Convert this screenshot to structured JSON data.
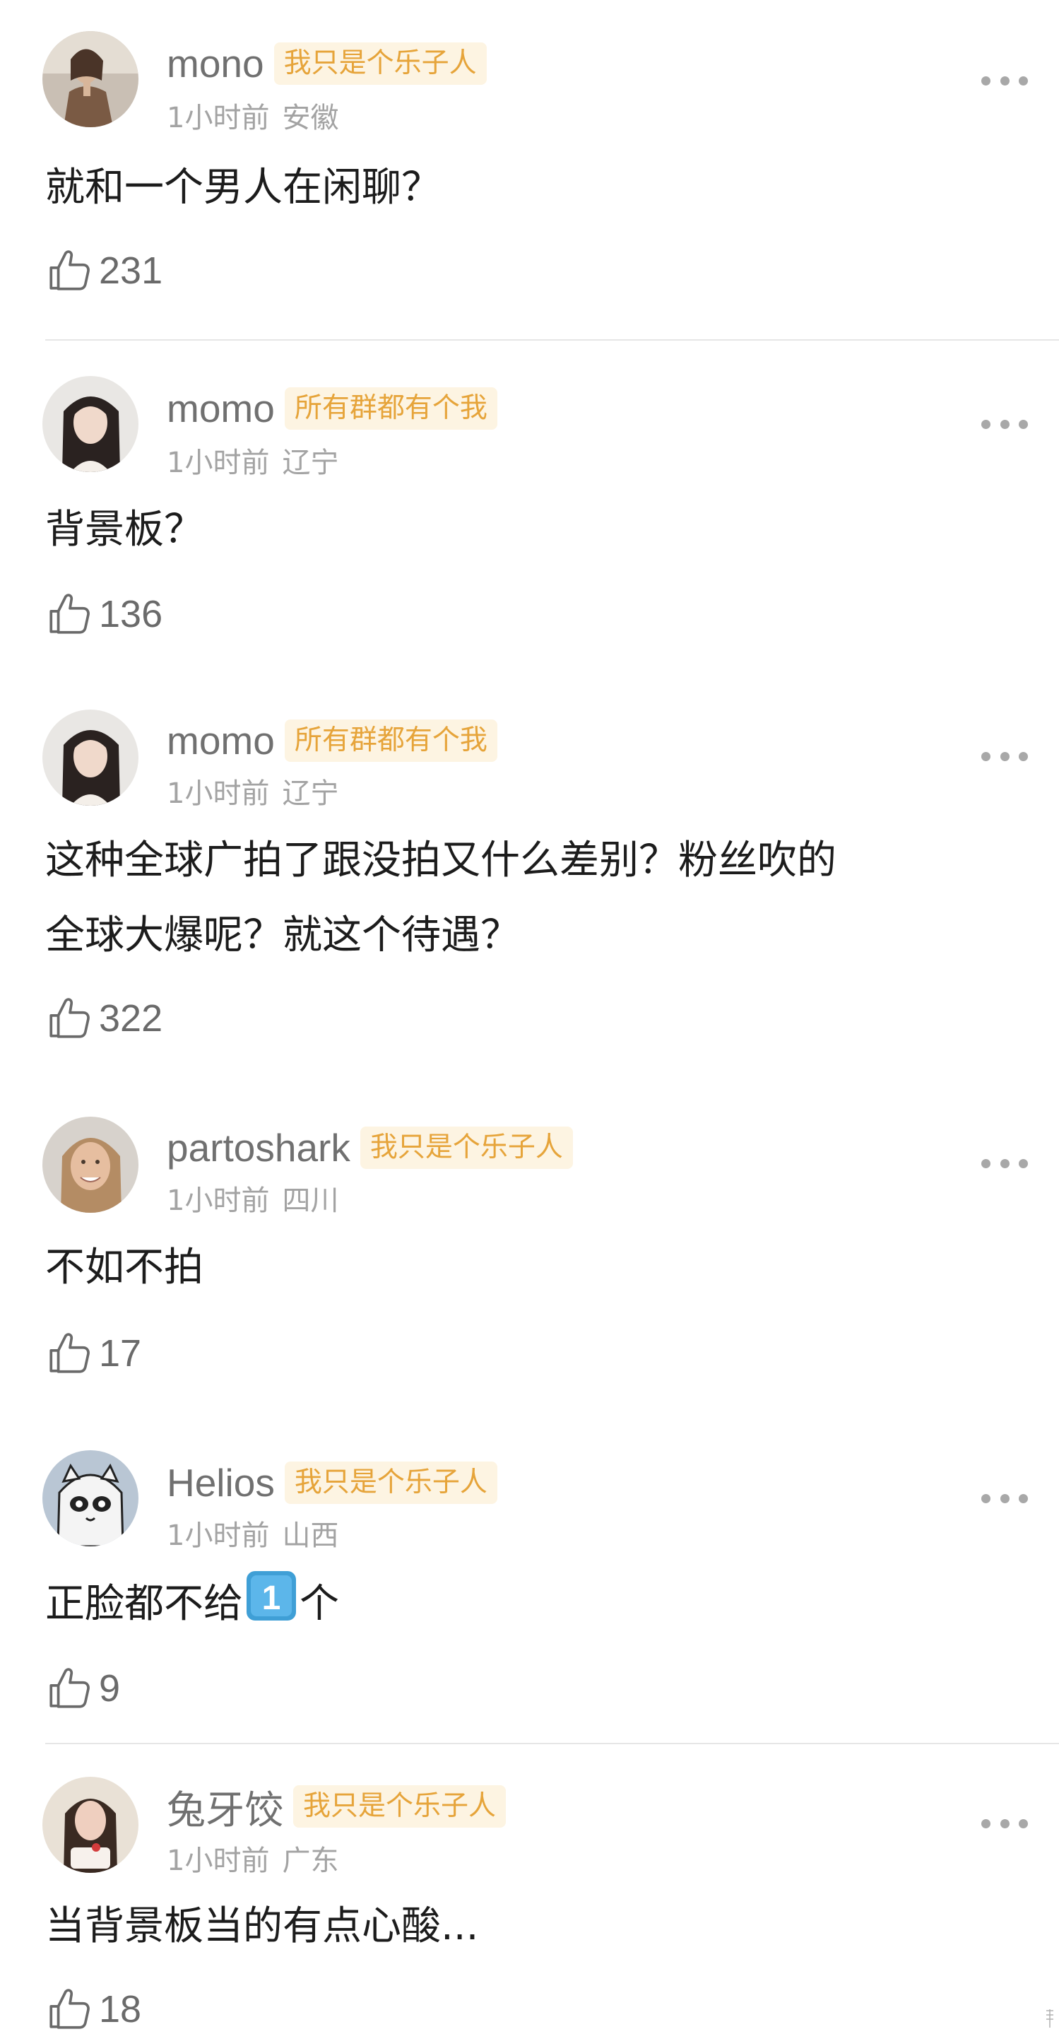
{
  "colors": {
    "username": "#707070",
    "tag_bg": "#fdf4e2",
    "tag_text": "#e6a43a",
    "meta": "#a3a3a3",
    "body_text": "#1c1c1c",
    "divider": "#e6e6e6"
  },
  "comments": [
    {
      "username": "mono",
      "tag": "我只是个乐子人",
      "time": "1小时前",
      "location": "安徽",
      "text": "就和一个男人在闲聊？",
      "likes": "231",
      "avatar": "avatar-photo-woman-coat"
    },
    {
      "username": "momo",
      "tag": "所有群都有个我",
      "time": "1小时前",
      "location": "辽宁",
      "text": "背景板？",
      "likes": "136",
      "avatar": "avatar-photo-girl-dark-hair"
    },
    {
      "username": "momo",
      "tag": "所有群都有个我",
      "time": "1小时前",
      "location": "辽宁",
      "text_line1": "这种全球广拍了跟没拍又什么差别？粉丝吹的",
      "text_line2": "全球大爆呢？就这个待遇？",
      "likes": "322",
      "avatar": "avatar-photo-girl-dark-hair"
    },
    {
      "username": "partoshark",
      "tag": "我只是个乐子人",
      "time": "1小时前",
      "location": "四川",
      "text": "不如不拍",
      "likes": "17",
      "avatar": "avatar-photo-smiling-woman"
    },
    {
      "username": "Helios",
      "tag": "我只是个乐子人",
      "time": "1小时前",
      "location": "山西",
      "text_before": "正脸都不给",
      "text_emoji": "1️⃣",
      "text_after": "个",
      "likes": "9",
      "avatar": "avatar-cartoon-raccoon"
    },
    {
      "username": "兔牙饺",
      "tag": "我只是个乐子人",
      "time": "1小时前",
      "location": "广东",
      "text": "当背景板当的有点心酸...",
      "likes": "18",
      "avatar": "avatar-photo-woman-cake"
    }
  ]
}
